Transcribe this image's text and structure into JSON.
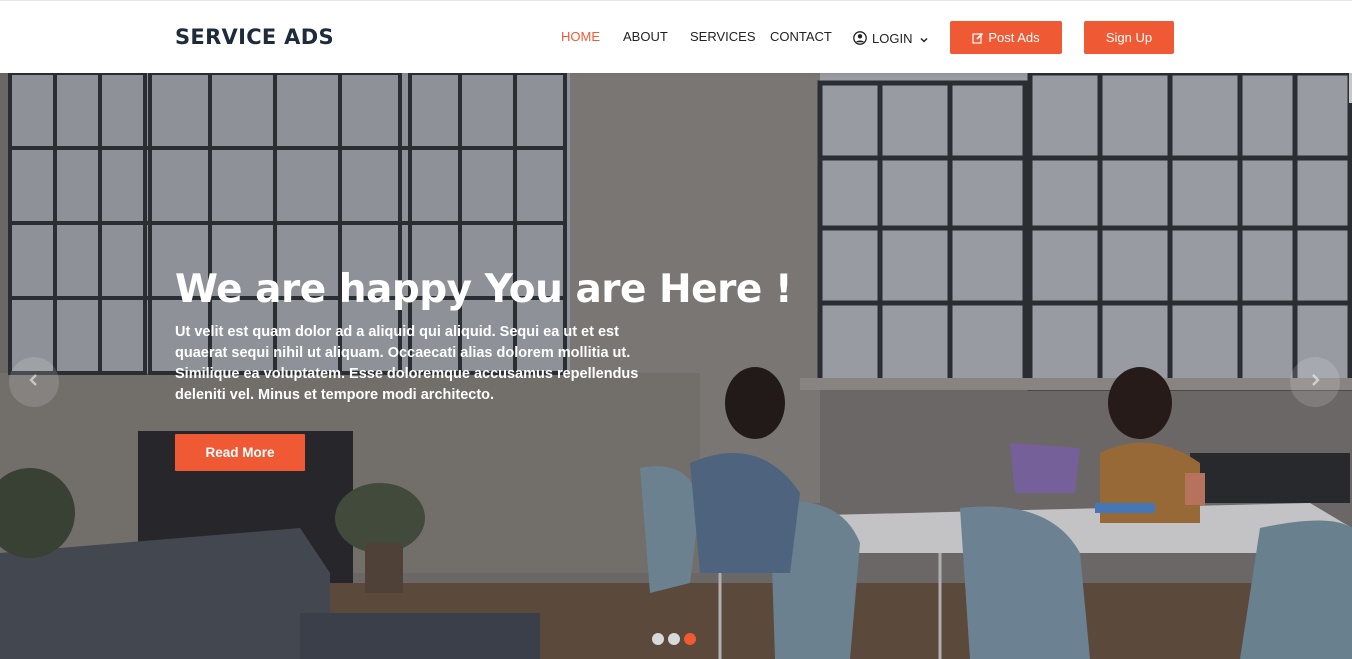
{
  "brand": {
    "name": "SERVICE ADS"
  },
  "nav": {
    "items": [
      {
        "label": "HOME",
        "active": true
      },
      {
        "label": "ABOUT",
        "active": false
      },
      {
        "label": "SERVICES",
        "active": false
      },
      {
        "label": "CONTACT",
        "active": false
      }
    ],
    "login": {
      "label": "LOGIN",
      "icon": "user-circle-icon",
      "caret": "chevron-down-icon"
    }
  },
  "actions": {
    "post_ads": {
      "label": "Post Ads",
      "icon": "edit-icon"
    },
    "sign_up": {
      "label": "Sign Up"
    }
  },
  "hero": {
    "title": "We are happy You are Here !",
    "text": "Ut velit est quam dolor ad a aliquid qui aliquid. Sequi ea ut et est quaerat sequi nihil ut aliquam. Occaecati alias dolorem mollitia ut. Similique ea voluptatem. Esse doloremque accusamus repellendus deleniti vel. Minus et tempore modi architecto.",
    "cta": "Read More",
    "prev_icon": "chevron-left-icon",
    "next_icon": "chevron-right-icon",
    "slides_total": 3,
    "active_slide": 3
  },
  "colors": {
    "accent": "#ef5a35",
    "brand_text": "#1d2b3a",
    "nav_text": "#222222"
  }
}
